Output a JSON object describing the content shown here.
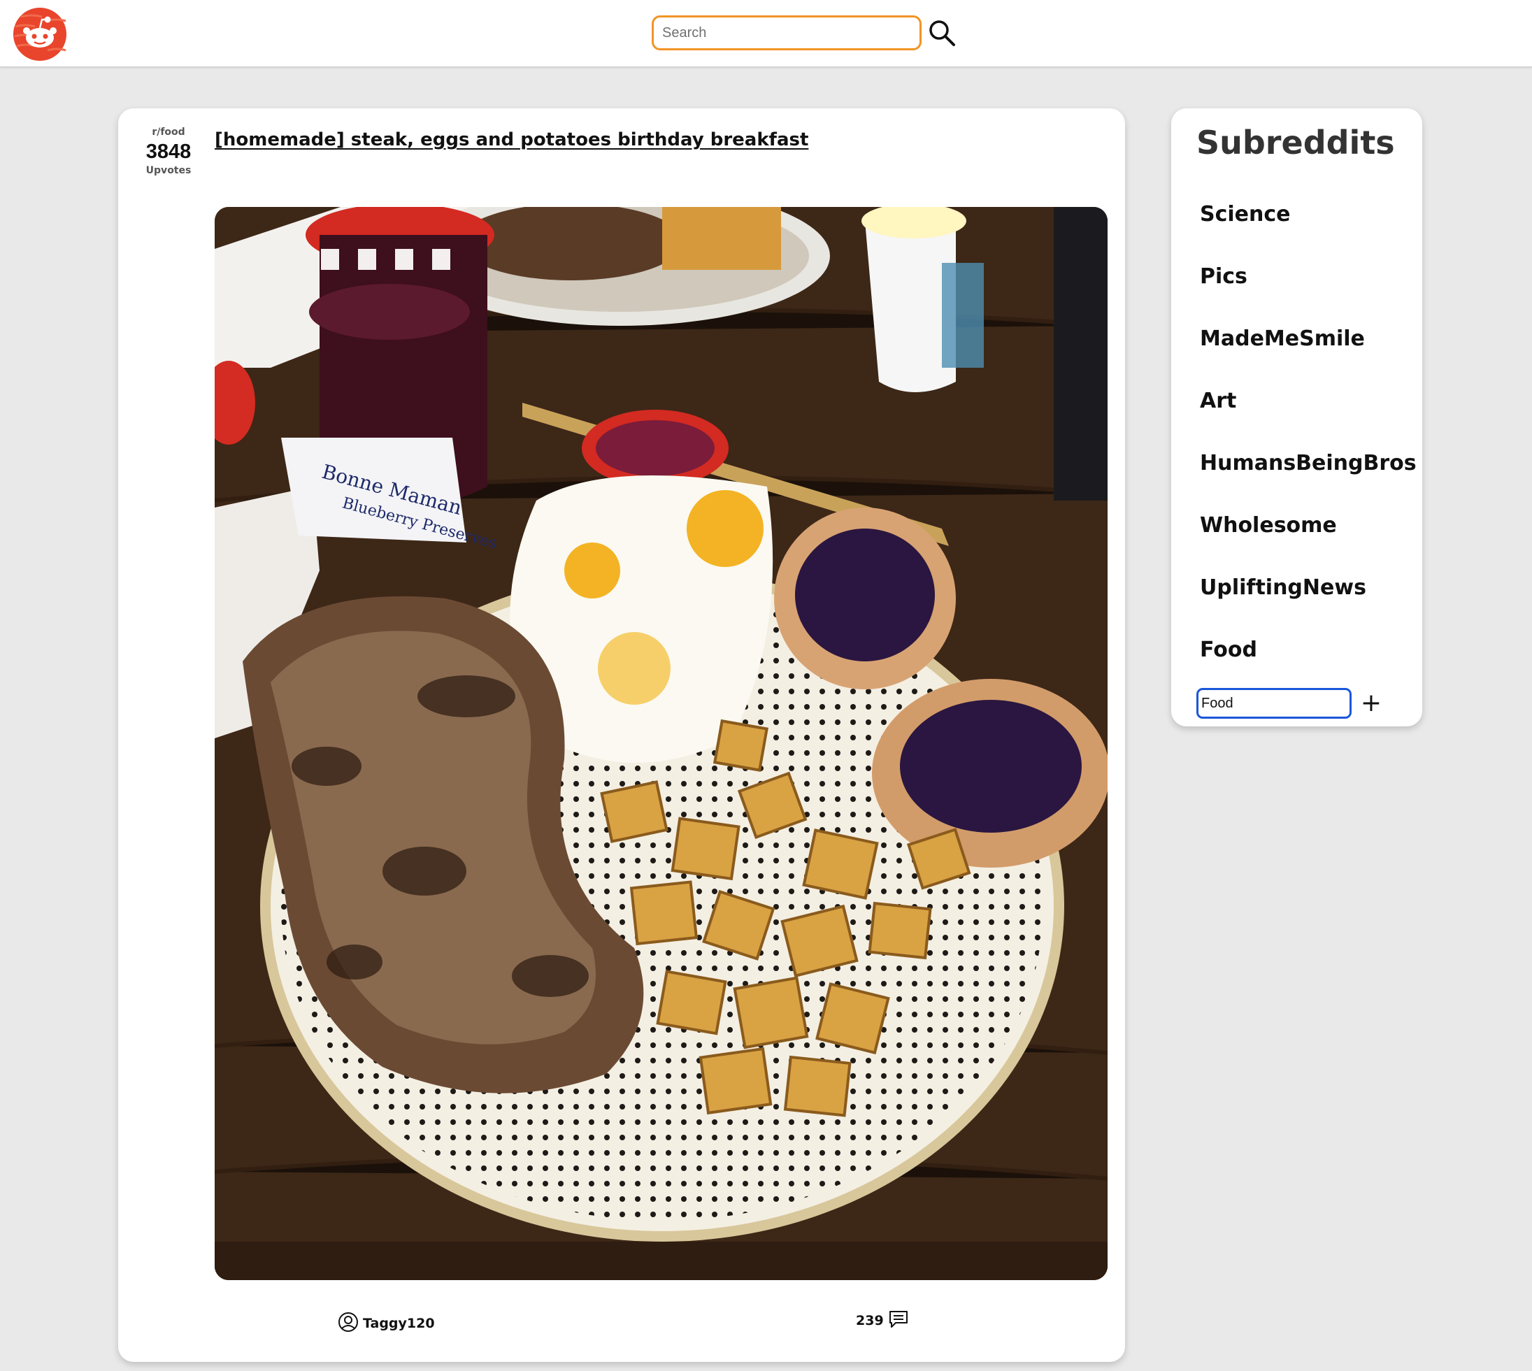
{
  "header": {
    "logo_icon": "reddit-alien-logo-icon",
    "search_placeholder": "Search",
    "search_value": "",
    "search_icon": "search-icon",
    "accent_color": "#f29425"
  },
  "post": {
    "subreddit": "r/food",
    "upvotes": "3848",
    "upvotes_label": "Upvotes",
    "title": "[homemade] steak, eggs and potatoes birthday breakfast",
    "author": "Taggy120",
    "author_icon": "user-circle-icon",
    "comment_count": "239",
    "comment_icon": "comment-icon"
  },
  "sidebar": {
    "title": "Subreddits",
    "items": [
      {
        "label": "Science"
      },
      {
        "label": "Pics"
      },
      {
        "label": "MadeMeSmile"
      },
      {
        "label": "Art"
      },
      {
        "label": "HumansBeingBros"
      },
      {
        "label": "Wholesome"
      },
      {
        "label": "UpliftingNews"
      },
      {
        "label": "Food"
      }
    ],
    "add_input_value": "Food",
    "add_button_label": "+",
    "input_border_color": "#1a56db"
  }
}
